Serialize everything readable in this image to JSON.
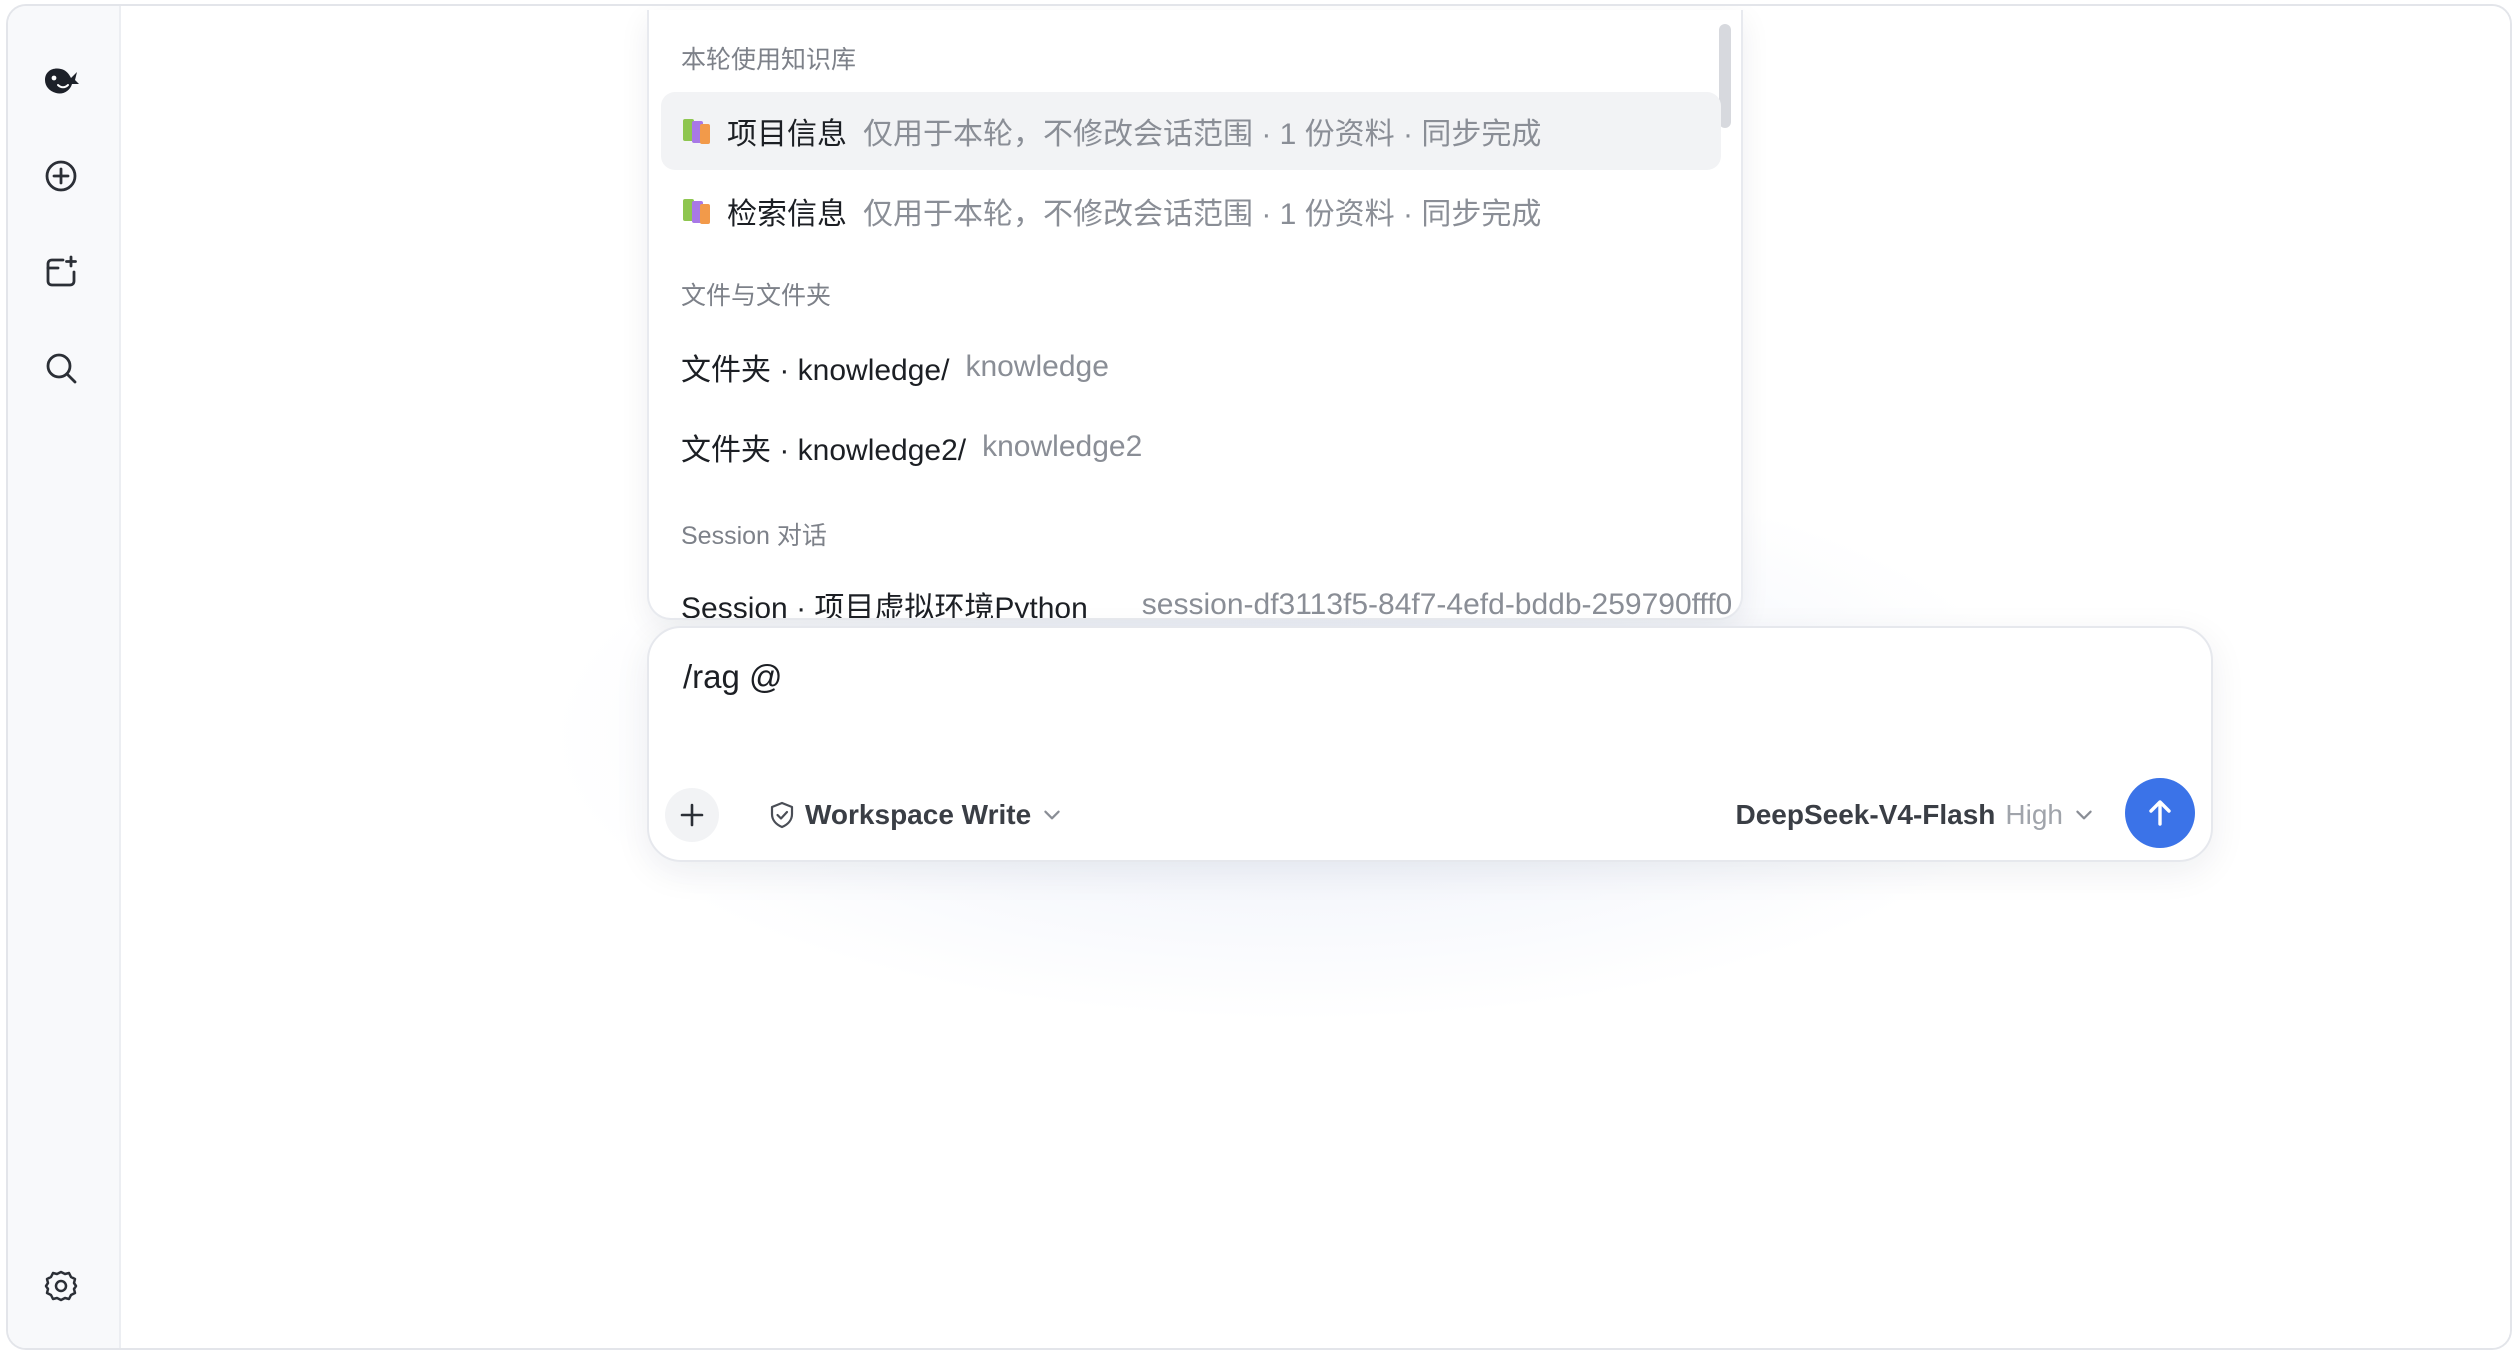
{
  "sidebar": {
    "logo_icon": "whale-logo-icon",
    "items": [
      {
        "name": "new-chat",
        "icon": "plus-circle-icon"
      },
      {
        "name": "new-folder",
        "icon": "folder-plus-icon"
      },
      {
        "name": "search",
        "icon": "search-icon"
      }
    ],
    "settings_icon": "gear-icon"
  },
  "popup": {
    "sections": {
      "knowledge_base": "本轮使用知识库",
      "files": "文件与文件夹",
      "sessions": "Session 对话"
    },
    "knowledge_items": [
      {
        "title": "项目信息",
        "desc": "仅用于本轮，不修改会话范围 · 1 份资料 · 同步完成"
      },
      {
        "title": "检索信息",
        "desc": "仅用于本轮，不修改会话范围 · 1 份资料 · 同步完成"
      }
    ],
    "file_items": [
      {
        "title": "文件夹 · knowledge/",
        "desc": "knowledge"
      },
      {
        "title": "文件夹 · knowledge2/",
        "desc": "knowledge2"
      }
    ],
    "session_items": [
      {
        "title": "Session · 项目虚拟环境Python",
        "desc": "session-df3113f5-84f7-4efd-bddb-259790fff0"
      }
    ]
  },
  "composer": {
    "input_value": "/rag @",
    "permission_label": "Workspace Write",
    "model_name": "DeepSeek-V4-Flash",
    "model_level": "High"
  },
  "colors": {
    "accent": "#3b73e8",
    "muted_text": "#8a8e96",
    "primary_text": "#1c1f24"
  }
}
